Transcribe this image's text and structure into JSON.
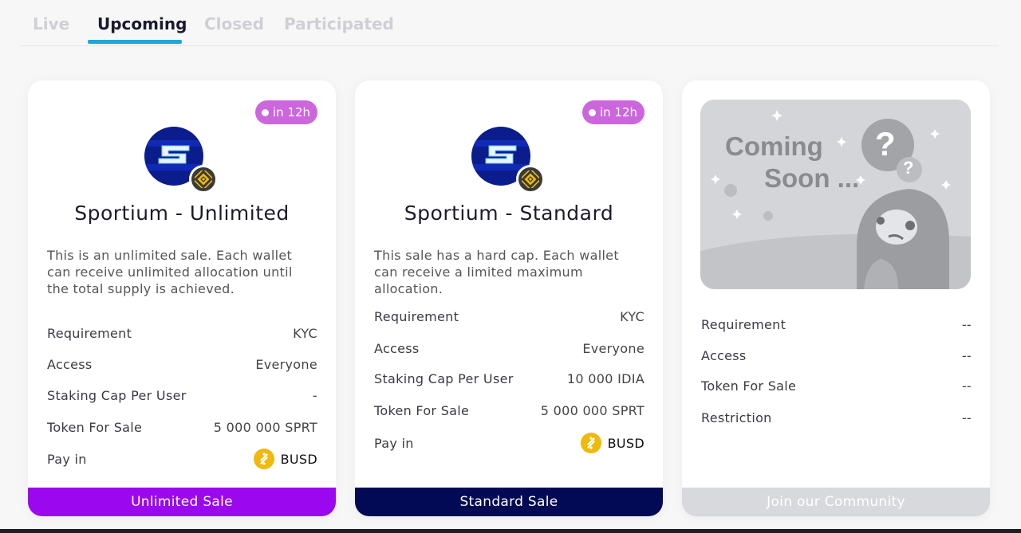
{
  "tabs": [
    {
      "label": "Live"
    },
    {
      "label": "Upcoming"
    },
    {
      "label": "Closed"
    },
    {
      "label": "Participated"
    }
  ],
  "cards": [
    {
      "badge": "in 12h",
      "title": "Sportium - Unlimited",
      "description": "This is an unlimited sale. Each wallet can receive unlimited allocation until the total supply is achieved.",
      "rows": [
        {
          "label": "Requirement",
          "value": "KYC"
        },
        {
          "label": "Access",
          "value": "Everyone"
        },
        {
          "label": "Staking Cap Per User",
          "value": "-"
        },
        {
          "label": "Token For Sale",
          "value": "5 000 000 SPRT"
        },
        {
          "label": "Pay in",
          "value": "BUSD"
        }
      ],
      "footer": "Unlimited Sale"
    },
    {
      "badge": "in 12h",
      "title": "Sportium - Standard",
      "description": "This sale has a hard cap. Each wallet can receive a limited maximum allocation.",
      "rows": [
        {
          "label": "Requirement",
          "value": "KYC"
        },
        {
          "label": "Access",
          "value": "Everyone"
        },
        {
          "label": "Staking Cap Per User",
          "value": "10 000 IDIA"
        },
        {
          "label": "Token For Sale",
          "value": "5 000 000 SPRT"
        },
        {
          "label": "Pay in",
          "value": "BUSD"
        }
      ],
      "footer": "Standard Sale"
    },
    {
      "image_text_line1": "Coming",
      "image_text_line2": "Soon ...",
      "rows": [
        {
          "label": "Requirement",
          "value": "--"
        },
        {
          "label": "Access",
          "value": "--"
        },
        {
          "label": "Token For Sale",
          "value": "--"
        },
        {
          "label": "Restriction",
          "value": "--"
        }
      ],
      "footer": "Join our Community"
    }
  ],
  "icons": {
    "project_logo": "sportium-logo-icon",
    "chain": "bnb-chain-icon",
    "pay_token": "busd-coin-icon"
  },
  "colors": {
    "tab_active_underline": "#22a6d9",
    "badge": "#cc66dd",
    "unlimited_footer": "#9b08f0",
    "standard_footer": "#020a55",
    "community_footer": "#d8d9dc",
    "busd": "#f0b90b"
  }
}
